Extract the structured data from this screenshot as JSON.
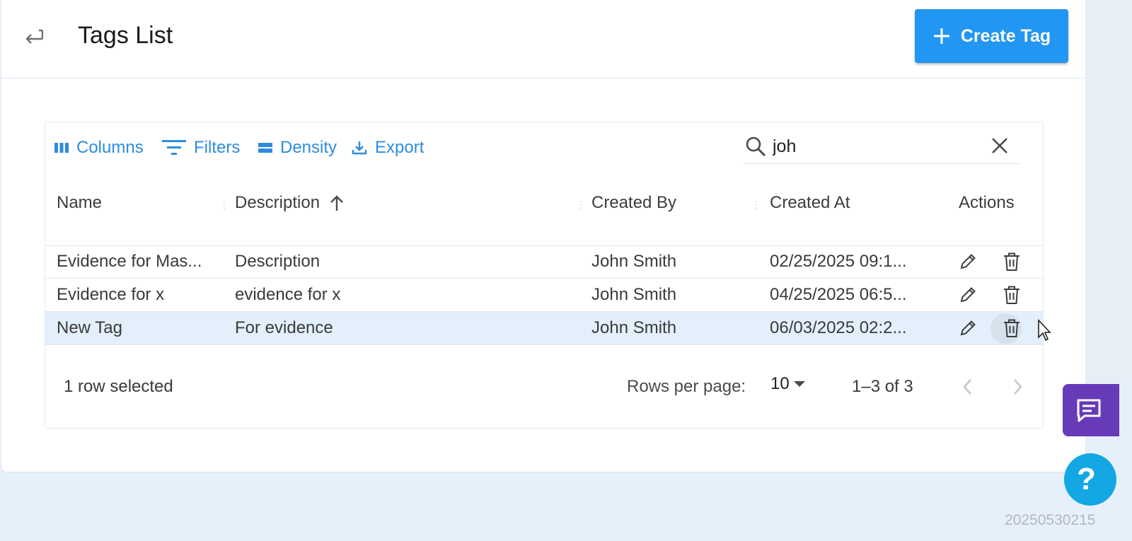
{
  "header": {
    "title": "Tags List",
    "create_label": "Create Tag"
  },
  "toolbar": {
    "columns_label": "Columns",
    "filters_label": "Filters",
    "density_label": "Density",
    "export_label": "Export"
  },
  "search": {
    "value": "joh"
  },
  "table": {
    "columns": [
      "Name",
      "Description",
      "Created By",
      "Created At",
      "Actions"
    ],
    "sort": {
      "column": "Description",
      "direction": "asc"
    },
    "rows": [
      {
        "name": "Evidence for Mas...",
        "description": "Description",
        "created_by": "John Smith",
        "created_at": "02/25/2025 09:1...",
        "selected": false
      },
      {
        "name": "Evidence for x",
        "description": "evidence for x",
        "created_by": "John Smith",
        "created_at": "04/25/2025 06:5...",
        "selected": false
      },
      {
        "name": "New Tag",
        "description": "For evidence",
        "created_by": "John Smith",
        "created_at": "06/03/2025 02:2...",
        "selected": true
      }
    ]
  },
  "footer": {
    "selection_text": "1 row selected",
    "rows_per_page_label": "Rows per page:",
    "rows_per_page_value": "10",
    "range_text": "1–3 of 3"
  },
  "stamp": "20250530215"
}
